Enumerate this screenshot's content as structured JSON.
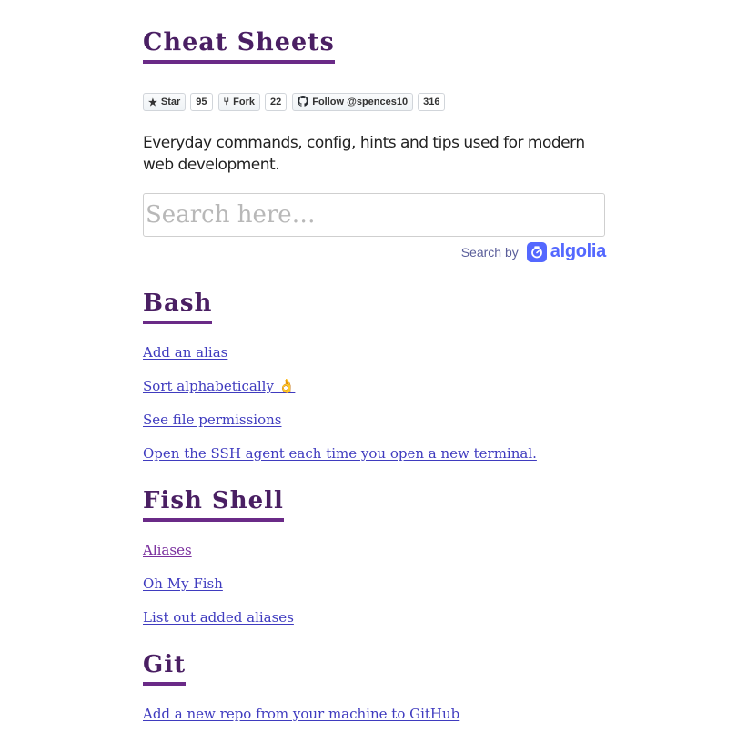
{
  "site": {
    "title": "Cheat Sheets",
    "intro": "Everyday commands, config, hints and tips used for modern web development."
  },
  "github": {
    "star_label": "Star",
    "star_count": "95",
    "fork_label": "Fork",
    "fork_count": "22",
    "follow_label": "Follow @spences10",
    "follow_count": "316"
  },
  "search": {
    "placeholder": "Search here…",
    "powered_by": "Search by",
    "provider": "algolia"
  },
  "sections": [
    {
      "title": "Bash",
      "links": [
        {
          "label": "Add an alias",
          "visited": false
        },
        {
          "label": "Sort alphabetically 👌",
          "visited": false
        },
        {
          "label": "See file permissions",
          "visited": false
        },
        {
          "label": "Open the SSH agent each time you open a new terminal.",
          "visited": false
        }
      ]
    },
    {
      "title": "Fish Shell",
      "links": [
        {
          "label": "Aliases",
          "visited": true
        },
        {
          "label": "Oh My Fish",
          "visited": false
        },
        {
          "label": "List out added aliases",
          "visited": false
        }
      ]
    },
    {
      "title": "Git",
      "links": [
        {
          "label": "Add a new repo from your machine to GitHub",
          "visited": false
        }
      ]
    }
  ],
  "colors": {
    "heading": "#4a1f63",
    "underline": "#6a2a87",
    "link": "#3f3bbf",
    "visited_link": "#7a2f9e",
    "algolia": "#5468ff"
  }
}
